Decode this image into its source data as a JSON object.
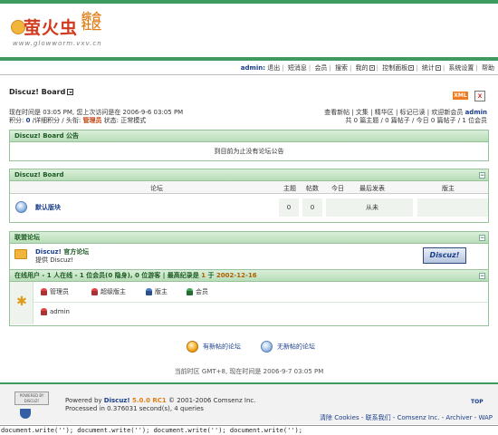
{
  "header": {
    "logo_title": "萤火虫",
    "logo_sub": "综合社区",
    "logo_url": "www.glowworm.vxv.cn"
  },
  "menu": {
    "user": "admin:",
    "items": [
      "退出",
      "短消息",
      "会员",
      "搜索",
      "我的",
      "控制面板",
      "统计",
      "系统设置",
      "帮助"
    ]
  },
  "board": {
    "title": "Discuz! Board",
    "xml": "XML",
    "close": "x"
  },
  "info": {
    "line1": "现在时间是 03:05 PM, 您上次访问是在 2006-9-6 03:05 PM",
    "line2_prefix": "积分: ",
    "line2_points": "0",
    "line2_rest": " /详细积分 / 头衔: ",
    "line2_title": "管理员",
    "line2_status": " 状态: 正常模式",
    "right1": "查看新帖 | 文集 | 精华区 | 标记已读 | 欢迎新会员 ",
    "right1_user": "admin",
    "right2": "共 0 篇主题 / 0 篇帖子 / 今日 0 篇帖子 / 1 位会员"
  },
  "announcement": {
    "header": "Discuz! Board 公告",
    "body": "到目前为止没有论坛公告"
  },
  "forums": {
    "header": "Discuz! Board",
    "collapse": "−",
    "columns": [
      "论坛",
      "主题",
      "帖数",
      "今日",
      "最后发表",
      "版主"
    ],
    "rows": [
      {
        "name": "默认版块",
        "threads": "0",
        "posts": "0",
        "today": "0",
        "last": "从未"
      }
    ]
  },
  "links": {
    "header": "联盟论坛",
    "collapse": "−",
    "name_prefix": "Discuz! ",
    "name_suffix": "官方论坛",
    "desc": "提供 Discuz!",
    "banner": "Discuz!"
  },
  "online": {
    "header_prefix": "在线用户 - ",
    "header_mid": "1 人在线 - 1 位会员(0 隐身), 0 位游客 | 最高纪录是 ",
    "record_count": "1",
    "record_date_prefix": " 于 ",
    "record_date": "2002-12-16",
    "collapse": "−",
    "groups": [
      "管理员",
      "超级版主",
      "版主",
      "会员"
    ],
    "users": [
      "admin"
    ]
  },
  "legend": {
    "new": "有新帖的论坛",
    "old": "无新帖的论坛"
  },
  "timeline": "当前时区 GMT+8, 现在时间是 2006-9-7 03:05 PM",
  "footer": {
    "badge": "POWERED BY DISCUZ!",
    "powered_prefix": "Powered by ",
    "product": "Discuz!",
    "version": " 5.0.0 RC1",
    "copyright": " © 2001-2006 Comsenz Inc.",
    "processed": "Processed in 0.376031 second(s), 4 queries",
    "top": "TOP",
    "right": "清除 Cookies - 联系我们 - Comsenz Inc. - Archiver - WAP"
  },
  "status_bar": "document.write(''); document.write(''); document.write(''); document.write('');"
}
